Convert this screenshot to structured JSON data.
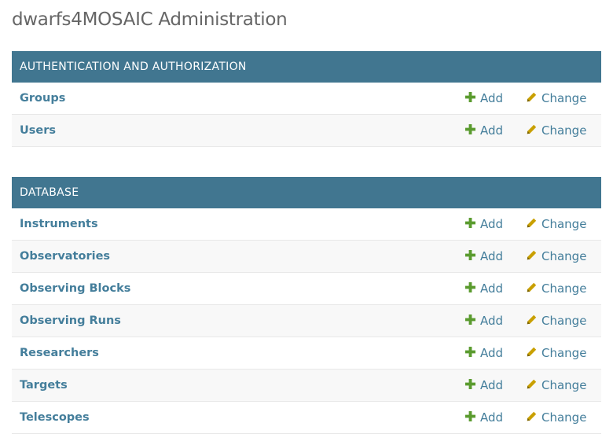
{
  "page": {
    "title": "dwarfs4MOSAIC Administration"
  },
  "colors": {
    "caption_bg": "#417690",
    "link": "#447e9b",
    "add_icon": "#5a9b2e",
    "change_icon": "#c9a000"
  },
  "modules": [
    {
      "caption": "AUTHENTICATION AND AUTHORIZATION",
      "models": [
        {
          "name": "Groups",
          "add": "Add",
          "change": "Change"
        },
        {
          "name": "Users",
          "add": "Add",
          "change": "Change"
        }
      ]
    },
    {
      "caption": "DATABASE",
      "models": [
        {
          "name": "Instruments",
          "add": "Add",
          "change": "Change"
        },
        {
          "name": "Observatories",
          "add": "Add",
          "change": "Change"
        },
        {
          "name": "Observing Blocks",
          "add": "Add",
          "change": "Change"
        },
        {
          "name": "Observing Runs",
          "add": "Add",
          "change": "Change"
        },
        {
          "name": "Researchers",
          "add": "Add",
          "change": "Change"
        },
        {
          "name": "Targets",
          "add": "Add",
          "change": "Change"
        },
        {
          "name": "Telescopes",
          "add": "Add",
          "change": "Change"
        }
      ]
    }
  ]
}
